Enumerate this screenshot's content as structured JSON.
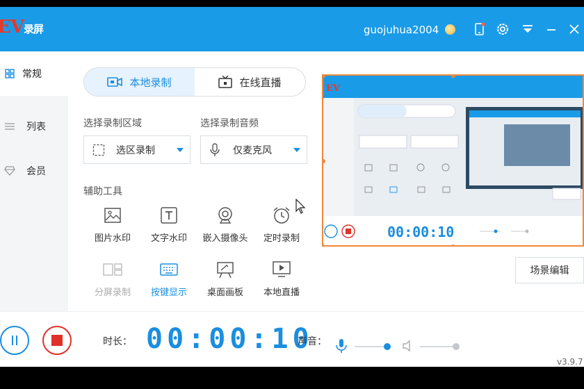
{
  "titlebar": {
    "logo_text": "EV",
    "logo_sub": "录屏",
    "username": "guojuhua2004",
    "icons": [
      "coin-icon",
      "phone-icon",
      "settings-icon",
      "menu-icon",
      "minimize-icon",
      "close-icon"
    ]
  },
  "sidebar": {
    "items": [
      {
        "label": "常规",
        "icon": "grid-icon",
        "active": true
      },
      {
        "label": "列表",
        "icon": "list-icon",
        "active": false
      },
      {
        "label": "会员",
        "icon": "diamond-icon",
        "active": false
      }
    ]
  },
  "tabs": [
    {
      "label": "本地录制",
      "icon": "video-icon",
      "active": true
    },
    {
      "label": "在线直播",
      "icon": "tv-icon",
      "active": false
    }
  ],
  "region": {
    "label": "选择录制区域",
    "value": "选区录制"
  },
  "audio": {
    "label": "选择录制音频",
    "value": "仅麦克风"
  },
  "tools": {
    "label": "辅助工具",
    "items": [
      {
        "label": "图片水印",
        "icon": "image-icon"
      },
      {
        "label": "文字水印",
        "icon": "text-icon"
      },
      {
        "label": "嵌入摄像头",
        "icon": "webcam-icon"
      },
      {
        "label": "定时录制",
        "icon": "alarm-icon"
      },
      {
        "label": "分屏录制",
        "icon": "split-screen-icon",
        "state": "disabled"
      },
      {
        "label": "按键显示",
        "icon": "keyboard-icon",
        "state": "highlight"
      },
      {
        "label": "桌面画板",
        "icon": "easel-icon"
      },
      {
        "label": "本地直播",
        "icon": "monitor-play-icon"
      }
    ]
  },
  "scene_button": "场景编辑",
  "bottom": {
    "duration_label": "时长：",
    "time": "00:00:10",
    "sound_label": "声音：",
    "mic_level": 0.9,
    "speaker_level": 1.0,
    "version": "v3.9.7"
  },
  "colors": {
    "accent": "#1a8ee0",
    "titlebar": "#1a9be8",
    "stop": "#e0302a",
    "preview_border": "#f0883a"
  }
}
